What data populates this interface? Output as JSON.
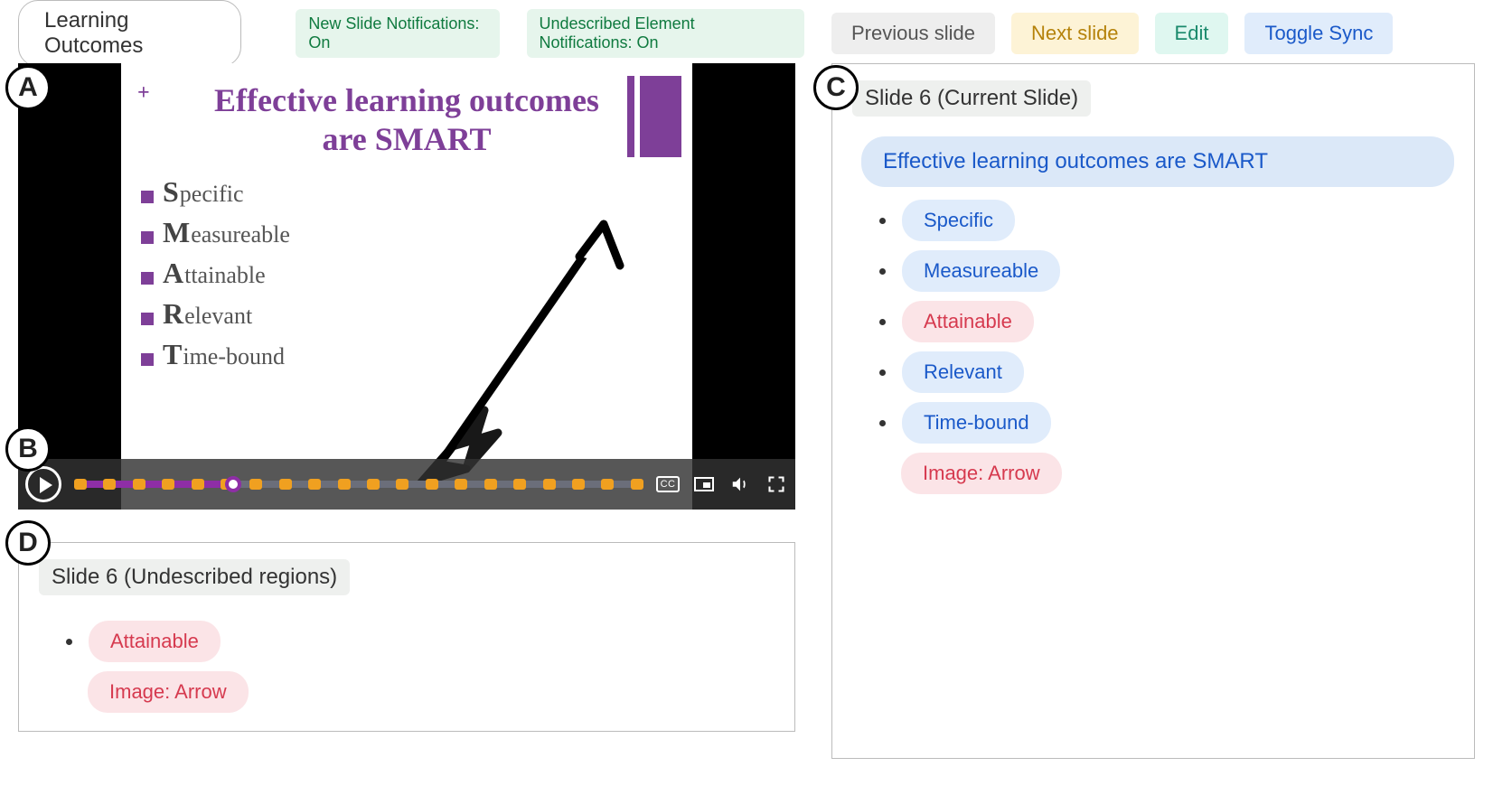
{
  "presentation_title": "Learning Outcomes",
  "notifications": {
    "new_slide": "New Slide Notifications: On",
    "undescribed": "Undescribed Element Notifications: On"
  },
  "toolbar": {
    "prev": "Previous slide",
    "next": "Next slide",
    "edit": "Edit",
    "toggle_sync": "Toggle Sync"
  },
  "annotations": {
    "a": "A",
    "b": "B",
    "c": "C",
    "d": "D"
  },
  "slide": {
    "title_line1": "Effective learning outcomes",
    "title_line2": "are SMART",
    "items": [
      {
        "first": "S",
        "rest": "pecific"
      },
      {
        "first": "M",
        "rest": "easureable"
      },
      {
        "first": "A",
        "rest": "ttainable"
      },
      {
        "first": "R",
        "rest": "elevant"
      },
      {
        "first": "T",
        "rest": "ime-bound"
      }
    ]
  },
  "video_controls": {
    "cc": "CC"
  },
  "current_panel": {
    "header": "Slide 6 (Current Slide)",
    "title": "Effective learning outcomes are SMART",
    "items": [
      {
        "label": "Specific",
        "style": "blue"
      },
      {
        "label": "Measureable",
        "style": "blue"
      },
      {
        "label": "Attainable",
        "style": "red"
      },
      {
        "label": "Relevant",
        "style": "blue"
      },
      {
        "label": "Time-bound",
        "style": "blue"
      }
    ],
    "image_label": "Image: Arrow"
  },
  "undescribed_panel": {
    "header": "Slide 6 (Undescribed regions)",
    "items": [
      {
        "label": "Attainable",
        "style": "red"
      }
    ],
    "image_label": "Image: Arrow"
  }
}
